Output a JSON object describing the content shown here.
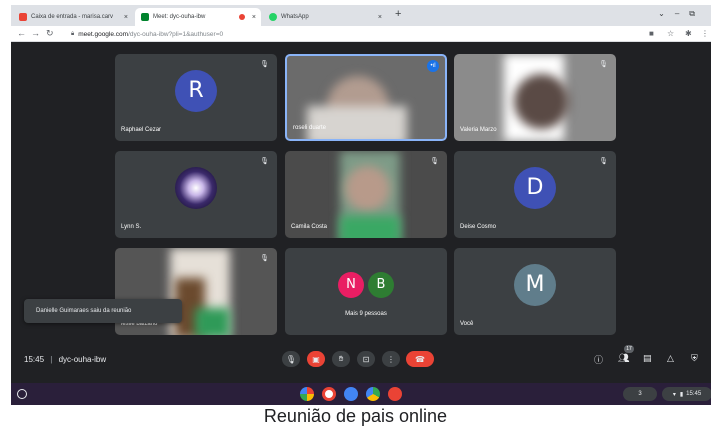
{
  "browser": {
    "tabs": [
      {
        "title": "Caixa de entrada - marisa.carv",
        "favicon_color": "#ea4335",
        "active": false
      },
      {
        "title": "Meet: dyc-ouha-ibw",
        "favicon_color": "#00832d",
        "active": true
      },
      {
        "title": "WhatsApp",
        "favicon_color": "#25d366",
        "active": false
      }
    ],
    "close_glyph": "×",
    "new_tab_glyph": "+",
    "url_domain": "meet.google.com",
    "url_path": "/dyc-ouha-ibw?pli=1&authuser=0"
  },
  "participants": [
    {
      "name": "Raphael Cezar",
      "initial": "R",
      "avatar_color": "#3f51b5",
      "type": "avatar"
    },
    {
      "name": "roseli duarte",
      "type": "video",
      "speaking": true
    },
    {
      "name": "Valeria Marzo",
      "type": "video"
    },
    {
      "name": "Lynn S.",
      "type": "image"
    },
    {
      "name": "Camila Costa",
      "type": "video"
    },
    {
      "name": "Deise Cosmo",
      "initial": "D",
      "avatar_color": "#3f51b5",
      "type": "avatar"
    },
    {
      "name": "leslie balzano",
      "type": "video"
    },
    {
      "name": "Mais 9 pessoas",
      "initials": [
        "N",
        "B"
      ],
      "colors": [
        "#e91e63",
        "#2e7d32"
      ],
      "type": "group"
    },
    {
      "name": "Você",
      "initial": "M",
      "avatar_color": "#607d8b",
      "type": "avatar"
    }
  ],
  "toast": "Danielle Guimaraes saiu da reunião",
  "meeting": {
    "time": "15:45",
    "separator": "|",
    "code": "dyc-ouha-ibw",
    "participant_count": "17"
  },
  "shelf": {
    "tray_count": "3",
    "clock": "15:45"
  },
  "caption": "Reunião de pais online"
}
